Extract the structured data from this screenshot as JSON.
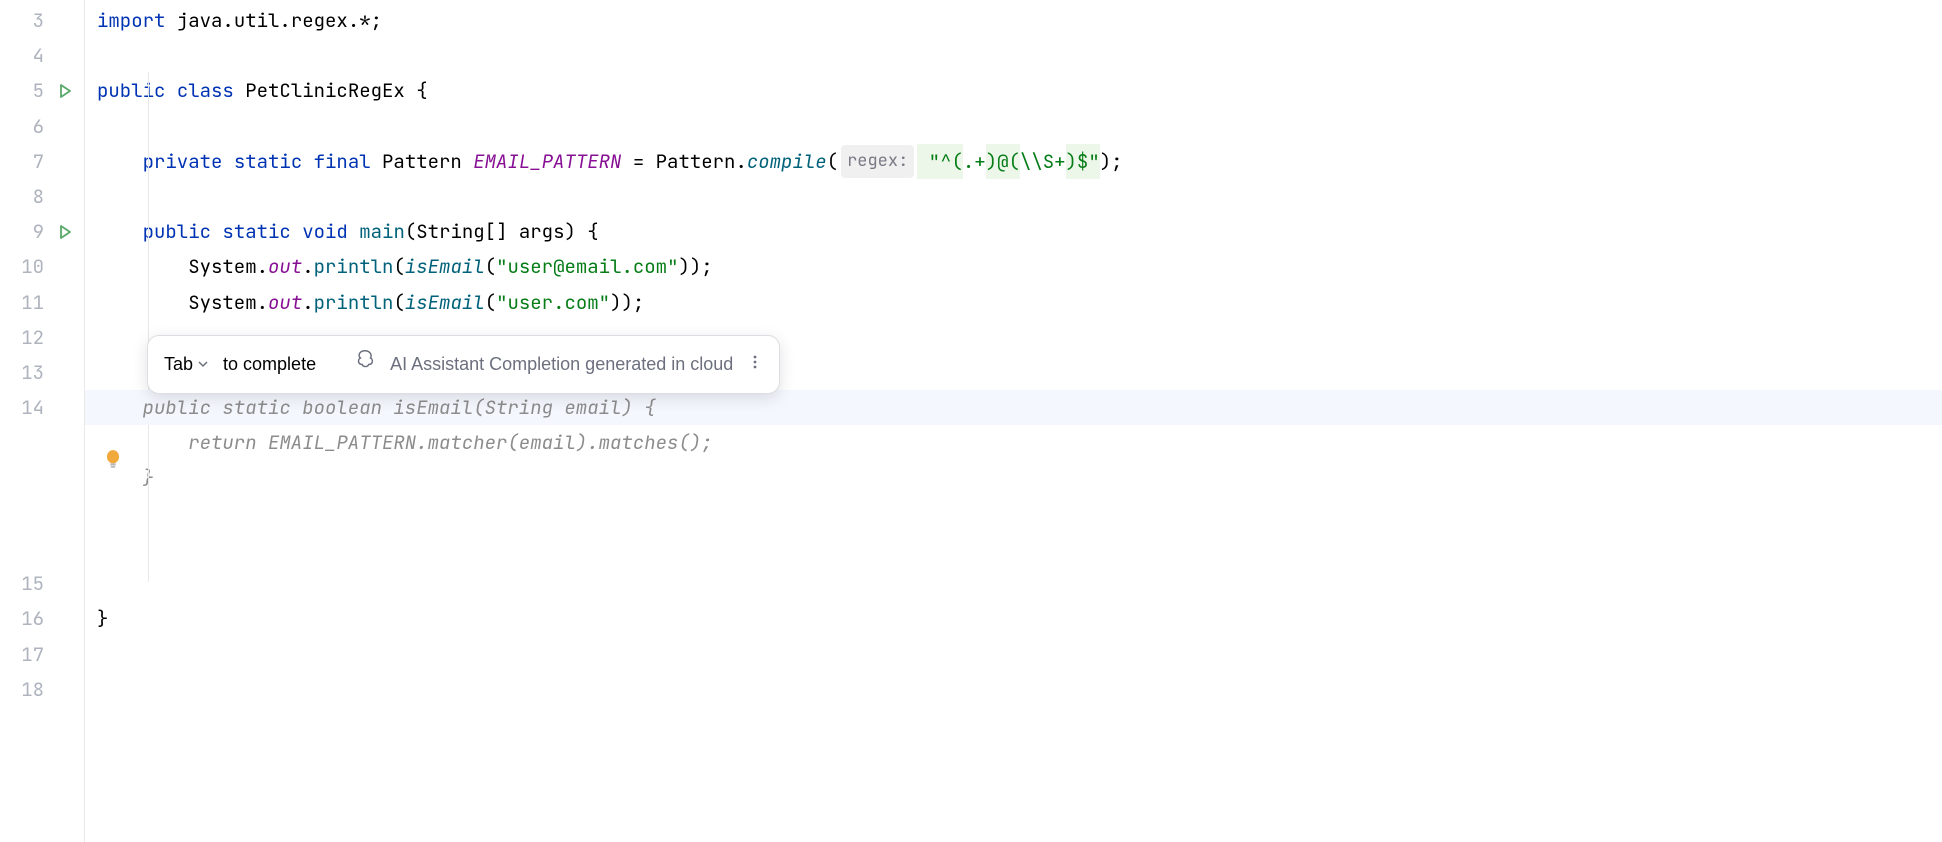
{
  "gutter": {
    "lines": [
      "3",
      "4",
      "5",
      "6",
      "7",
      "8",
      "9",
      "10",
      "11",
      "12",
      "13",
      "14",
      "15",
      "16",
      "17",
      "18"
    ],
    "run_icons_at": [
      2,
      6
    ]
  },
  "code": {
    "l3": {
      "kw_import": "import ",
      "pkg": "java.util.regex.*;"
    },
    "l5": {
      "kw_public": "public ",
      "kw_class": "class ",
      "name": "PetClinicRegEx ",
      "brace": "{"
    },
    "l7": {
      "indent": "    ",
      "kw_private": "private ",
      "kw_static": "static ",
      "kw_final": "final ",
      "type": "Pattern ",
      "field": "EMAIL_PATTERN",
      "eq": " = ",
      "cls": "Pattern",
      "dot": ".",
      "method": "compile",
      "paren_o": "(",
      "hint": "regex:",
      "str_a": " \"^(",
      "str_b": ".+",
      "str_c": ")@(",
      "str_d": "\\\\S+",
      "str_e": ")$\"",
      "close": ");"
    },
    "l9": {
      "indent": "    ",
      "kw_public": "public ",
      "kw_static": "static ",
      "kw_void": "void ",
      "name": "main",
      "params_o": "(",
      "ptype": "String[] ",
      "pname": "args",
      "params_c": ") {",
      "brace": ""
    },
    "l10": {
      "indent": "        ",
      "sys": "System.",
      "out": "out",
      "dot": ".",
      "println": "println",
      "po": "(",
      "call": "isEmail",
      "po2": "(",
      "str": "\"user@email.com\"",
      "close": "));"
    },
    "l11": {
      "indent": "        ",
      "sys": "System.",
      "out": "out",
      "dot": ".",
      "println": "println",
      "po": "(",
      "call": "isEmail",
      "po2": "(",
      "str": "\"user.com\"",
      "close": "));"
    },
    "l14": {
      "indent": "    ",
      "text": "public static boolean isEmail(String email) {"
    },
    "l14b": {
      "indent": "        ",
      "text": "return EMAIL_PATTERN.matcher(email).matches();"
    },
    "l14c": {
      "indent": "    ",
      "text": "}"
    },
    "l17": {
      "brace": "}"
    }
  },
  "popup": {
    "tab": "Tab",
    "to_complete": "to complete",
    "ai_text": "AI Assistant Completion generated in cloud"
  }
}
